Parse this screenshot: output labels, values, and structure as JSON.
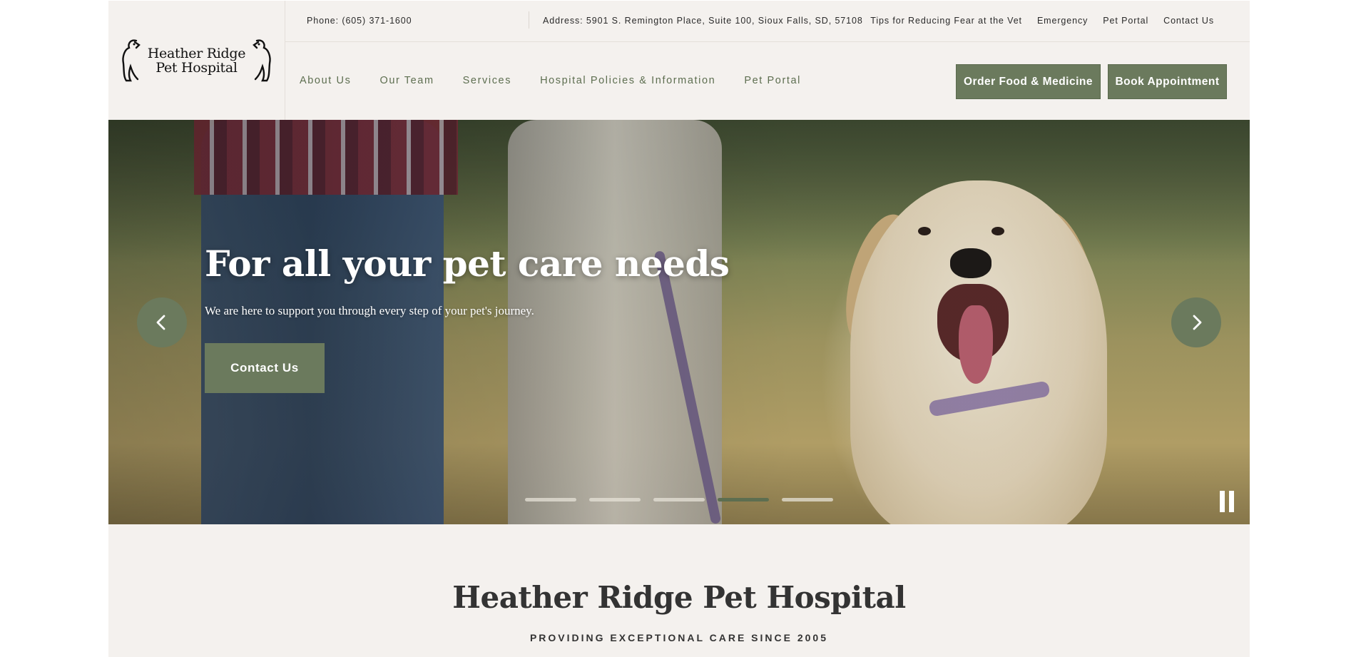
{
  "logo": {
    "line1": "Heather Ridge",
    "line2": "Pet Hospital"
  },
  "topbar": {
    "phone": "Phone: (605) 371-1600",
    "address": "Address: 5901 S. Remington Place, Suite 100, Sioux Falls, SD, 57108",
    "links": [
      "Tips for Reducing Fear at the Vet",
      "Emergency",
      "Pet Portal",
      "Contact Us"
    ]
  },
  "nav": [
    "About Us",
    "Our Team",
    "Services",
    "Hospital Policies & Information",
    "Pet Portal"
  ],
  "buttons": {
    "order": "Order Food & Medicine",
    "book": "Book Appointment"
  },
  "hero": {
    "title": "For all your pet care needs",
    "subtitle": "We are here to support you through every step of your pet's journey.",
    "cta": "Contact Us",
    "slide_count": 5,
    "active_slide": 4
  },
  "intro": {
    "title": "Heather Ridge Pet Hospital",
    "subtitle": "PROVIDING EXCEPTIONAL CARE SINCE 2005"
  },
  "colors": {
    "accent": "#6b7a5d",
    "nav_text": "#5d6e50",
    "background": "#f4f1ee"
  }
}
